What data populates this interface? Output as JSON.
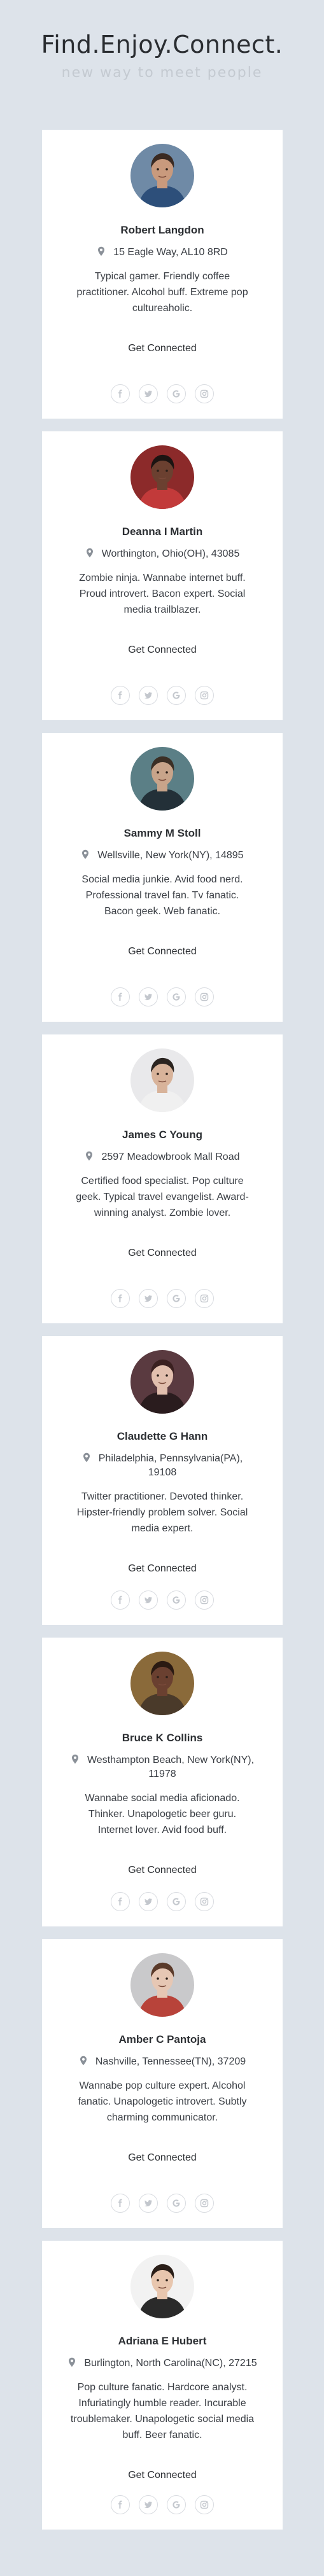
{
  "header": {
    "title": "Find.Enjoy.Connect.",
    "subtitle": "new way to meet people"
  },
  "cards": [
    {
      "name": "Robert Langdon",
      "location": "15 Eagle Way, AL10 8RD",
      "bio": "Typical gamer. Friendly coffee practitioner. Alcohol buff. Extreme pop cultureaholic.",
      "connect_label": "Get Connected"
    },
    {
      "name": "Deanna I Martin",
      "location": "Worthington, Ohio(OH), 43085",
      "bio": "Zombie ninja. Wannabe internet buff. Proud introvert. Bacon expert. Social media trailblazer.",
      "connect_label": "Get Connected"
    },
    {
      "name": "Sammy M Stoll",
      "location": "Wellsville, New York(NY), 14895",
      "bio": "Social media junkie. Avid food nerd. Professional travel fan. Tv fanatic. Bacon geek. Web fanatic.",
      "connect_label": "Get Connected"
    },
    {
      "name": "James C Young",
      "location": "2597 Meadowbrook Mall Road",
      "bio": "Certified food specialist. Pop culture geek. Typical travel evangelist. Award-winning analyst. Zombie lover.",
      "connect_label": "Get Connected"
    },
    {
      "name": "Claudette G Hann",
      "location": "Philadelphia, Pennsylvania(PA), 19108",
      "bio": "Twitter practitioner. Devoted thinker. Hipster-friendly problem solver. Social media expert.",
      "connect_label": "Get Connected"
    },
    {
      "name": "Bruce K Collins",
      "location": "Westhampton Beach, New York(NY), 11978",
      "bio": "Wannabe social media aficionado. Thinker. Unapologetic beer guru. Internet lover. Avid food buff.",
      "connect_label": "Get Connected"
    },
    {
      "name": "Amber C Pantoja",
      "location": "Nashville, Tennessee(TN), 37209",
      "bio": "Wannabe pop culture expert. Alcohol fanatic. Unapologetic introvert. Subtly charming communicator.",
      "connect_label": "Get Connected"
    },
    {
      "name": "Adriana E Hubert",
      "location": "Burlington, North Carolina(NC), 27215",
      "bio": "Pop culture fanatic. Hardcore analyst. Infuriatingly humble reader. Incurable troublemaker. Unapologetic social media buff. Beer fanatic.",
      "connect_label": "Get Connected"
    }
  ],
  "social_icons": [
    "facebook-icon",
    "twitter-icon",
    "google-icon",
    "instagram-icon"
  ],
  "colors": {
    "background": "#dde3ea",
    "card": "#ffffff",
    "text": "#2c2f33",
    "subtitle": "#c4cad1",
    "icon": "#c3c7cd"
  }
}
